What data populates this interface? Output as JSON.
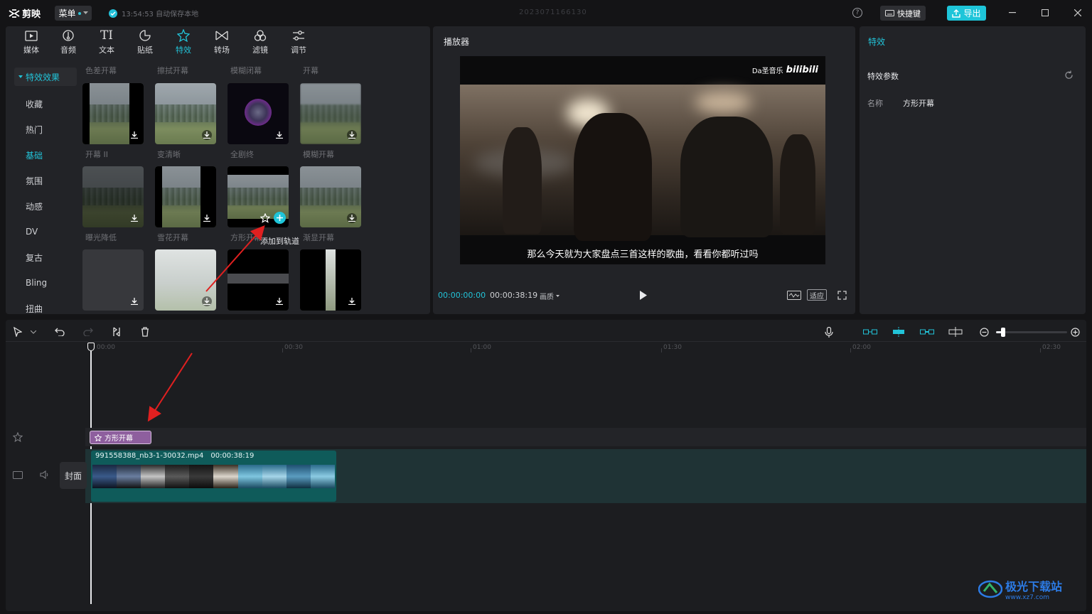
{
  "app": {
    "logo_text": "剪映",
    "menu_label": "菜单",
    "autosave_text": "13:54:53 自动保存本地",
    "project_title": "2023071166130",
    "shortcut_label": "快捷键",
    "export_label": "导出"
  },
  "toolbar": {
    "tabs": [
      {
        "label": "媒体",
        "icon": "media-icon"
      },
      {
        "label": "音频",
        "icon": "audio-icon"
      },
      {
        "label": "文本",
        "icon": "text-icon"
      },
      {
        "label": "贴纸",
        "icon": "sticker-icon"
      },
      {
        "label": "特效",
        "icon": "effects-icon",
        "active": true
      },
      {
        "label": "转场",
        "icon": "transition-icon"
      },
      {
        "label": "滤镜",
        "icon": "filter-icon"
      },
      {
        "label": "调节",
        "icon": "adjust-icon"
      }
    ]
  },
  "categories": {
    "header": "特效效果",
    "items": [
      "收藏",
      "热门",
      "基础",
      "氛围",
      "动感",
      "DV",
      "复古",
      "Bling",
      "扭曲"
    ],
    "active": "基础"
  },
  "effects": {
    "top_row_labels": [
      "色差开幕",
      "擦拭开幕",
      "模糊闭幕",
      "开幕"
    ],
    "row1_labels": [
      "开幕 II",
      "变清晰",
      "全剧终",
      "模糊开幕"
    ],
    "row2_labels": [
      "曝光降低",
      "雪花开幕",
      "方形开幕",
      "渐显开幕"
    ],
    "hover_tooltip": "添加到轨道"
  },
  "player": {
    "title": "播放器",
    "subtitle": "那么今天就为大家盘点三首这样的歌曲，看看你都听过吗",
    "watermark_text": "Da圣音乐",
    "watermark_logo": "bilibili",
    "current_time": "00:00:00:00",
    "total_time": "00:00:38:19",
    "quality_label": "画质",
    "fit_label": "适应"
  },
  "right_panel": {
    "tab_title": "特效",
    "section_title": "特效参数",
    "name_label": "名称",
    "name_value": "方形开幕"
  },
  "timeline": {
    "ruler": [
      "00:00",
      "00:30",
      "01:00",
      "01:30",
      "02:00",
      "02:30"
    ],
    "effect_clip_label": "方形开幕",
    "video_clip_name": "991558388_nb3-1-30032.mp4",
    "video_clip_duration": "00:00:38:19",
    "cover_label": "封面",
    "zoom_level": 0.1
  },
  "watermark": {
    "text": "极光下载站",
    "url": "www.xz7.com"
  },
  "colors": {
    "accent": "#22c3d8",
    "effect_clip": "#8e5f9e",
    "video_clip": "#0f5b5a",
    "arrow": "#e02020"
  }
}
